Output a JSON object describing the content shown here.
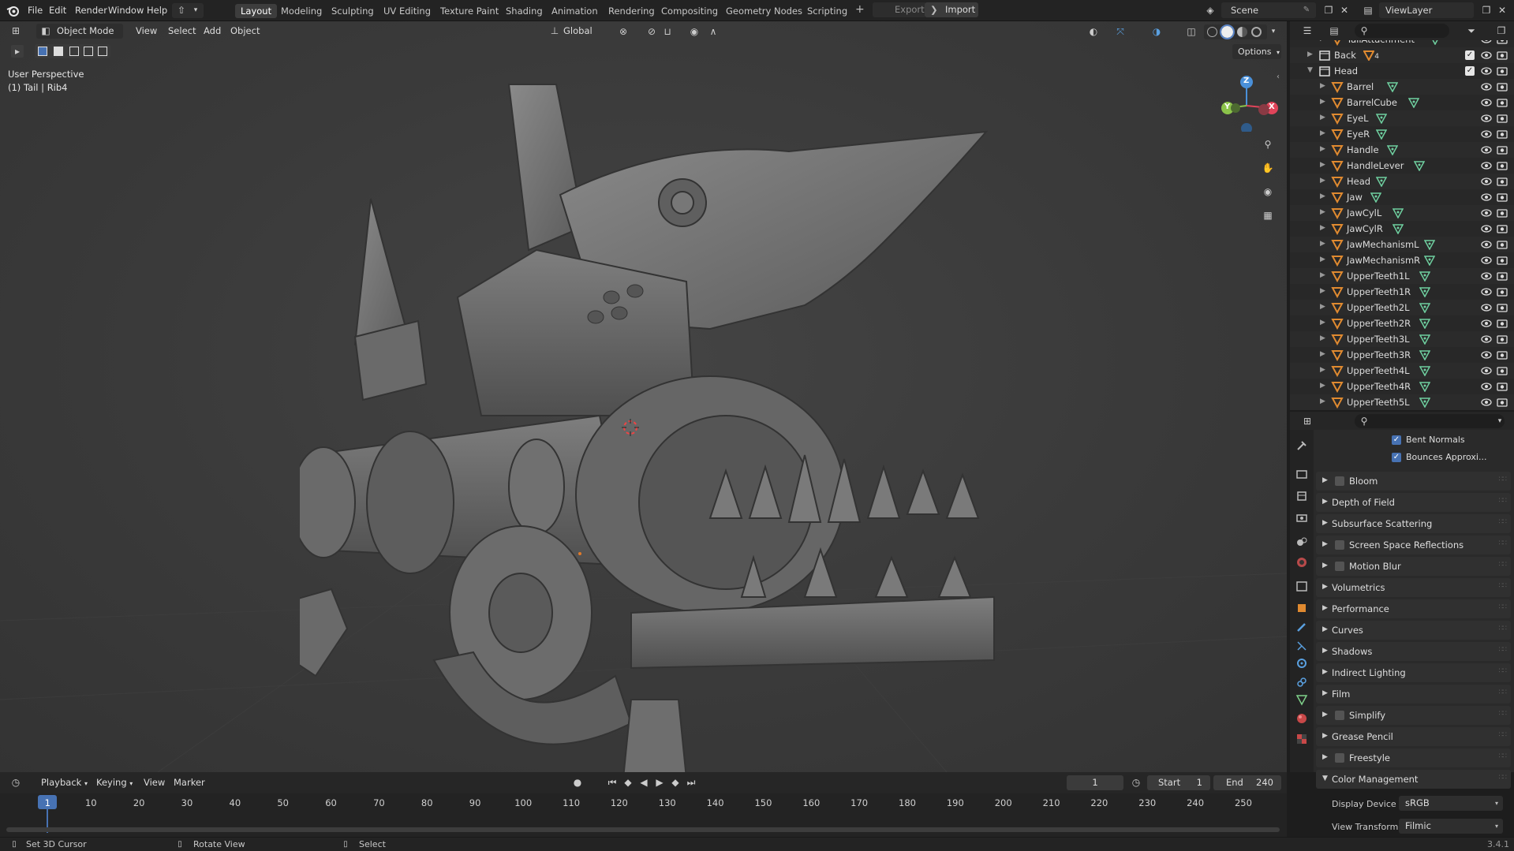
{
  "app": {
    "menu": [
      "File",
      "Edit",
      "Render",
      "Window",
      "Help"
    ],
    "workspaces": [
      "Layout",
      "Modeling",
      "Sculpting",
      "UV Editing",
      "Texture Paint",
      "Shading",
      "Animation",
      "Rendering",
      "Compositing",
      "Geometry Nodes",
      "Scripting"
    ],
    "active_workspace": "Layout",
    "add_workspace": "+",
    "export_label": "Export",
    "import_label": "Import",
    "scene_name": "Scene",
    "view_layer": "ViewLayer",
    "version": "3.4.1"
  },
  "viewport": {
    "mode": "Object Mode",
    "menus": [
      "View",
      "Select",
      "Add",
      "Object"
    ],
    "transform_orientation": "Global",
    "options_label": "Options",
    "overlay_title": "User Perspective",
    "overlay_subtitle": "(1) Tail | Rib4",
    "gizmo_axes": {
      "x": "X",
      "y": "Y",
      "z": "Z"
    },
    "colors": {
      "x": "#e0445a",
      "y": "#8bc34a",
      "z": "#4a90d9"
    }
  },
  "outliner": {
    "rows": [
      {
        "name": "TailAttachment",
        "depth": 2,
        "expanded": false,
        "icon": "mesh-data-icon"
      },
      {
        "name": "Back",
        "depth": 1,
        "expanded": false,
        "icon": "collection-icon",
        "badge": "4",
        "checked": true
      },
      {
        "name": "Head",
        "depth": 1,
        "expanded": true,
        "icon": "collection-icon",
        "checked": true
      },
      {
        "name": "Barrel",
        "depth": 2,
        "icon": "mesh-data-icon"
      },
      {
        "name": "BarrelCube",
        "depth": 2,
        "icon": "mesh-data-icon"
      },
      {
        "name": "EyeL",
        "depth": 2,
        "icon": "mesh-data-icon"
      },
      {
        "name": "EyeR",
        "depth": 2,
        "icon": "mesh-data-icon"
      },
      {
        "name": "Handle",
        "depth": 2,
        "icon": "mesh-data-icon"
      },
      {
        "name": "HandleLever",
        "depth": 2,
        "icon": "mesh-data-icon"
      },
      {
        "name": "Head",
        "depth": 2,
        "icon": "mesh-data-icon"
      },
      {
        "name": "Jaw",
        "depth": 2,
        "icon": "mesh-data-icon"
      },
      {
        "name": "JawCylL",
        "depth": 2,
        "icon": "mesh-data-icon"
      },
      {
        "name": "JawCylR",
        "depth": 2,
        "icon": "mesh-data-icon"
      },
      {
        "name": "JawMechanismL",
        "depth": 2,
        "icon": "mesh-data-icon"
      },
      {
        "name": "JawMechanismR",
        "depth": 2,
        "icon": "mesh-data-icon"
      },
      {
        "name": "UpperTeeth1L",
        "depth": 2,
        "icon": "mesh-data-icon"
      },
      {
        "name": "UpperTeeth1R",
        "depth": 2,
        "icon": "mesh-data-icon"
      },
      {
        "name": "UpperTeeth2L",
        "depth": 2,
        "icon": "mesh-data-icon"
      },
      {
        "name": "UpperTeeth2R",
        "depth": 2,
        "icon": "mesh-data-icon"
      },
      {
        "name": "UpperTeeth3L",
        "depth": 2,
        "icon": "mesh-data-icon"
      },
      {
        "name": "UpperTeeth3R",
        "depth": 2,
        "icon": "mesh-data-icon"
      },
      {
        "name": "UpperTeeth4L",
        "depth": 2,
        "icon": "mesh-data-icon"
      },
      {
        "name": "UpperTeeth4R",
        "depth": 2,
        "icon": "mesh-data-icon"
      },
      {
        "name": "UpperTeeth5L",
        "depth": 2,
        "icon": "mesh-data-icon"
      }
    ]
  },
  "properties": {
    "checkbox_items": [
      {
        "label": "Bent Normals",
        "checked": true
      },
      {
        "label": "Bounces Approxi...",
        "checked": true
      }
    ],
    "panels": [
      {
        "label": "Bloom",
        "has_checkbox": true,
        "expanded": false
      },
      {
        "label": "Depth of Field",
        "has_checkbox": false,
        "expanded": false
      },
      {
        "label": "Subsurface Scattering",
        "has_checkbox": false,
        "expanded": false
      },
      {
        "label": "Screen Space Reflections",
        "has_checkbox": true,
        "expanded": false
      },
      {
        "label": "Motion Blur",
        "has_checkbox": true,
        "expanded": false
      },
      {
        "label": "Volumetrics",
        "has_checkbox": false,
        "expanded": false
      },
      {
        "label": "Performance",
        "has_checkbox": false,
        "expanded": false
      },
      {
        "label": "Curves",
        "has_checkbox": false,
        "expanded": false
      },
      {
        "label": "Shadows",
        "has_checkbox": false,
        "expanded": false
      },
      {
        "label": "Indirect Lighting",
        "has_checkbox": false,
        "expanded": false
      },
      {
        "label": "Film",
        "has_checkbox": false,
        "expanded": false
      },
      {
        "label": "Simplify",
        "has_checkbox": true,
        "expanded": false
      },
      {
        "label": "Grease Pencil",
        "has_checkbox": false,
        "expanded": false
      },
      {
        "label": "Freestyle",
        "has_checkbox": true,
        "expanded": false
      },
      {
        "label": "Color Management",
        "has_checkbox": false,
        "expanded": true
      }
    ],
    "display_device_label": "Display Device",
    "display_device_value": "sRGB",
    "view_transform_label": "View Transform",
    "view_transform_value": "Filmic"
  },
  "timeline": {
    "menus": [
      "Playback",
      "Keying",
      "View",
      "Marker"
    ],
    "current_frame": "1",
    "start_label": "Start",
    "start_value": "1",
    "end_label": "End",
    "end_value": "240",
    "ruler": [
      "1",
      "10",
      "20",
      "30",
      "40",
      "50",
      "60",
      "70",
      "80",
      "90",
      "100",
      "110",
      "120",
      "130",
      "140",
      "150",
      "160",
      "170",
      "180",
      "190",
      "200",
      "210",
      "220",
      "230",
      "240",
      "250"
    ]
  },
  "statusbar": {
    "items": [
      "Set 3D Cursor",
      "Rotate View",
      "Select"
    ]
  }
}
